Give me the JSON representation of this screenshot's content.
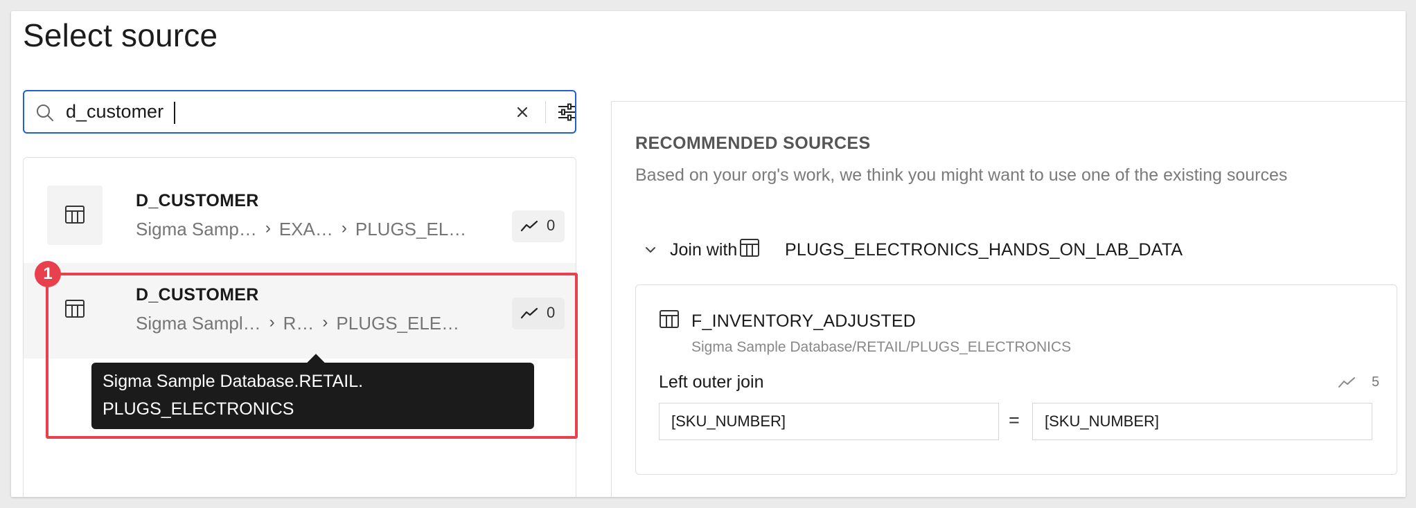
{
  "page": {
    "title": "Select source"
  },
  "search": {
    "value": "d_customer"
  },
  "results": [
    {
      "name": "D_CUSTOMER",
      "path": [
        "Sigma Samp…",
        "EXA…",
        "PLUGS_EL…"
      ],
      "usage": "0"
    },
    {
      "name": "D_CUSTOMER",
      "path": [
        "Sigma Sampl…",
        "R…",
        "PLUGS_ELE…"
      ],
      "usage": "0"
    }
  ],
  "tooltip": {
    "line1": "Sigma Sample Database.RETAIL.",
    "line2": "PLUGS_ELECTRONICS"
  },
  "annotation": {
    "step": "1",
    "color": "#e8404c"
  },
  "recommended": {
    "title": "RECOMMENDED SOURCES",
    "subtitle": "Based on your org's work, we think you might want to use one of the existing sources",
    "join_label": "Join with",
    "join_table": "PLUGS_ELECTRONICS_HANDS_ON_LAB_DATA",
    "card": {
      "name": "F_INVENTORY_ADJUSTED",
      "path": "Sigma Sample Database/RETAIL/PLUGS_ELECTRONICS",
      "join_type": "Left outer join",
      "usage": "5",
      "left_key": "[SKU_NUMBER]",
      "operator": "=",
      "right_key": "[SKU_NUMBER]"
    }
  },
  "colors": {
    "accent": "#1f5fd1",
    "highlight": "#e8404c",
    "tooltip_bg": "#1b1b1b"
  }
}
